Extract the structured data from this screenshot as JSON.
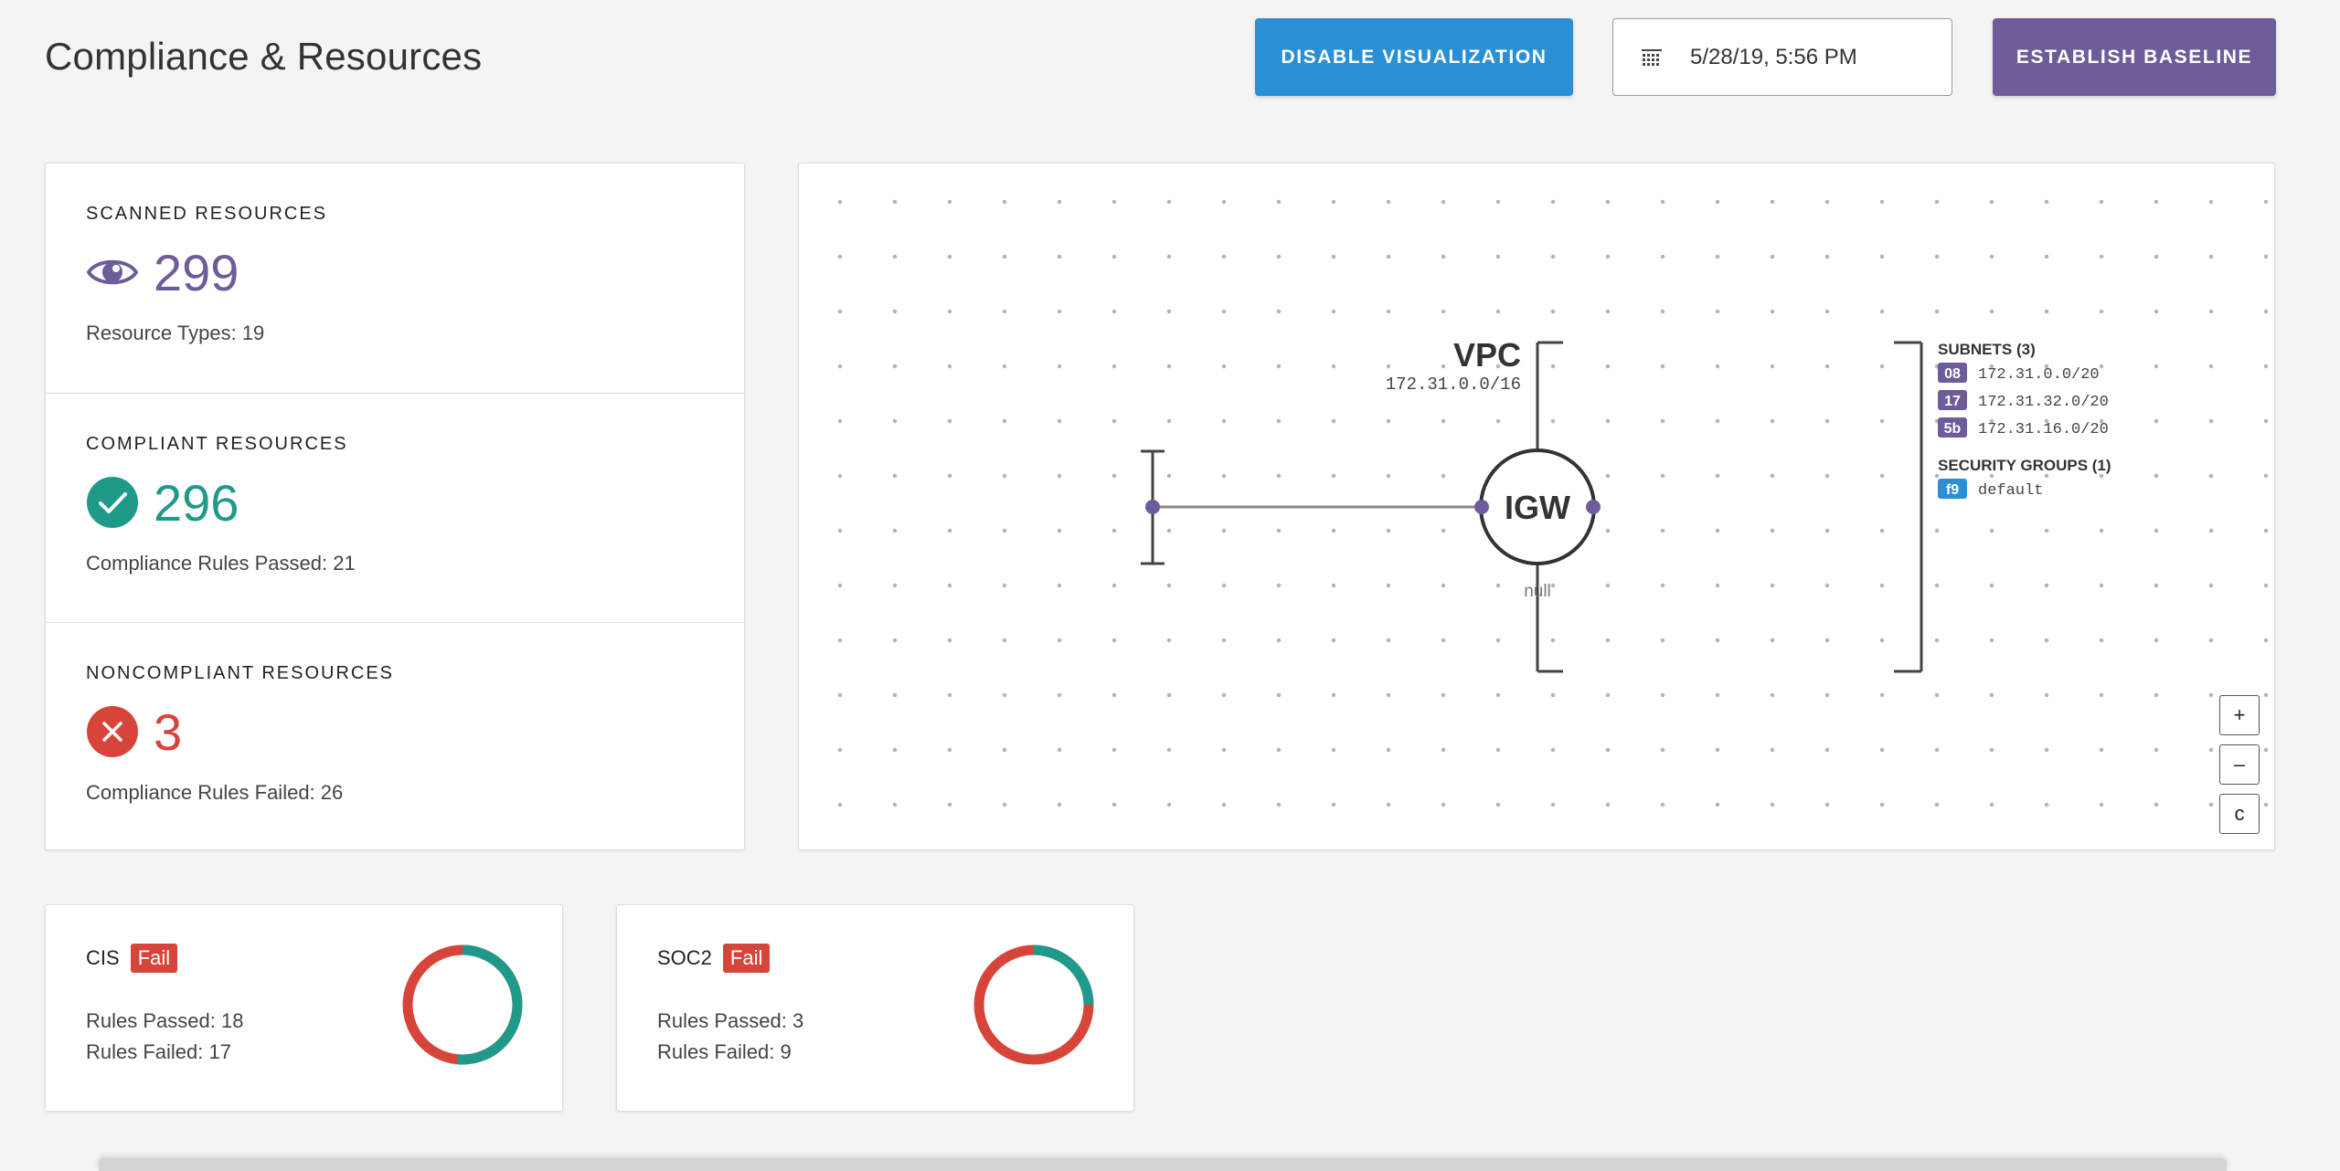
{
  "page": {
    "title": "Compliance & Resources"
  },
  "toolbar": {
    "disable_viz_label": "DISABLE VISUALIZATION",
    "date_value": "5/28/19, 5:56 PM",
    "baseline_label": "ESTABLISH BASELINE"
  },
  "stats": {
    "scanned": {
      "title": "SCANNED RESOURCES",
      "value": "299",
      "sub_label": "Resource Types:",
      "sub_value": "19",
      "color": "#6e5c9a",
      "icon": "eye-icon"
    },
    "compliant": {
      "title": "COMPLIANT RESOURCES",
      "value": "296",
      "sub_label": "Compliance Rules Passed:",
      "sub_value": "21",
      "color": "#1f9a8a",
      "icon": "check-circle-icon"
    },
    "noncompliant": {
      "title": "NONCOMPLIANT RESOURCES",
      "value": "3",
      "sub_label": "Compliance Rules Failed:",
      "sub_value": "26",
      "color": "#d7453a",
      "icon": "x-circle-icon"
    }
  },
  "diagram": {
    "vpc_label": "VPC",
    "vpc_cidr": "172.31.0.0/16",
    "igw_label": "IGW",
    "igw_sublabel": "null",
    "subnets_title": "SUBNETS (3)",
    "subnets": [
      {
        "tag": "08",
        "cidr": "172.31.0.0/20"
      },
      {
        "tag": "17",
        "cidr": "172.31.32.0/20"
      },
      {
        "tag": "5b",
        "cidr": "172.31.16.0/20"
      }
    ],
    "sg_title": "SECURITY GROUPS (1)",
    "security_groups": [
      {
        "tag": "f9",
        "name": "default"
      }
    ],
    "zoom": {
      "in": "+",
      "out": "–",
      "center": "c"
    }
  },
  "frameworks": {
    "cis": {
      "name": "CIS",
      "status": "Fail",
      "passed_label": "Rules Passed:",
      "passed": 18,
      "failed_label": "Rules Failed:",
      "failed": 17
    },
    "soc2": {
      "name": "SOC2",
      "status": "Fail",
      "passed_label": "Rules Passed:",
      "passed": 3,
      "failed_label": "Rules Failed:",
      "failed": 9
    }
  },
  "colors": {
    "pass": "#1f9a8a",
    "fail": "#d7453a",
    "accent_purple": "#6e5c9a",
    "accent_blue": "#2b8fd6",
    "sg_blue": "#2b8fd6"
  }
}
